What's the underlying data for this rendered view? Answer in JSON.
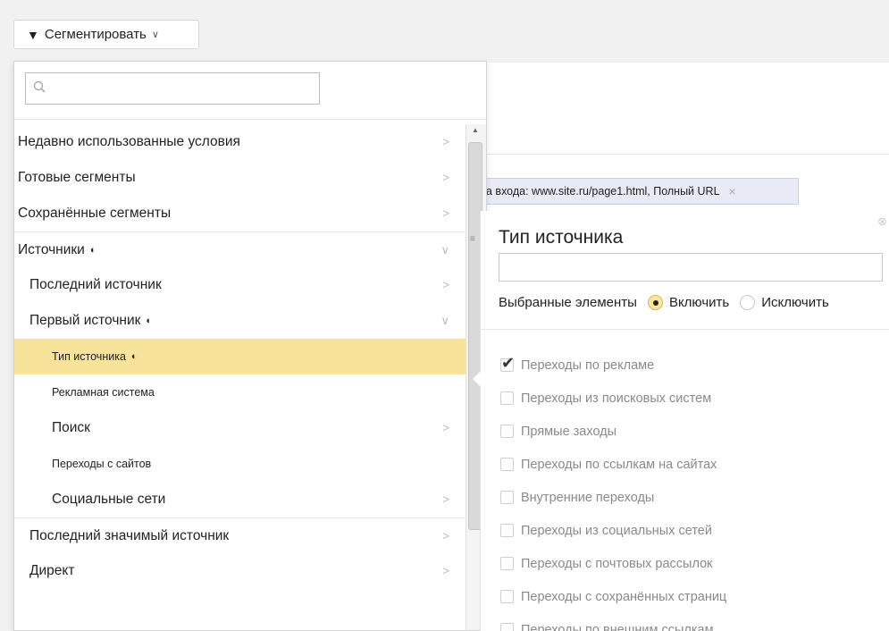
{
  "toolbar": {
    "segment_label": "Сегментировать"
  },
  "menu": {
    "items": [
      {
        "label": "Недавно использованные условия"
      },
      {
        "label": "Готовые сегменты"
      },
      {
        "label": "Сохранённые сегменты"
      },
      {
        "label": "Источники"
      },
      {
        "label": "Последний источник"
      },
      {
        "label": "Первый источник"
      },
      {
        "label": "Тип источника"
      },
      {
        "label": "Рекламная система"
      },
      {
        "label": "Поиск"
      },
      {
        "label": "Переходы с сайтов"
      },
      {
        "label": "Социальные сети"
      },
      {
        "label": "Последний значимый источник"
      },
      {
        "label": "Директ"
      }
    ]
  },
  "filter_chip": {
    "text": "а входа: www.site.ru/page1.html, Полный URL"
  },
  "panel": {
    "title": "Тип источника",
    "selected_label": "Выбранные элементы",
    "include_label": "Включить",
    "exclude_label": "Исключить",
    "options": [
      {
        "label": "Переходы по рекламе",
        "checked": true
      },
      {
        "label": "Переходы из поисковых систем",
        "checked": false
      },
      {
        "label": "Прямые заходы",
        "checked": false
      },
      {
        "label": "Переходы по ссылкам на сайтах",
        "checked": false
      },
      {
        "label": "Внутренние переходы",
        "checked": false
      },
      {
        "label": "Переходы из социальных сетей",
        "checked": false
      },
      {
        "label": "Переходы с почтовых рассылок",
        "checked": false
      },
      {
        "label": "Переходы с сохранённых страниц",
        "checked": false
      },
      {
        "label": "Переходы по внешним ссылкам",
        "checked": false
      }
    ]
  },
  "colors": {
    "active_row": "#f7e39a",
    "chip_bg": "#e8eaf6"
  }
}
